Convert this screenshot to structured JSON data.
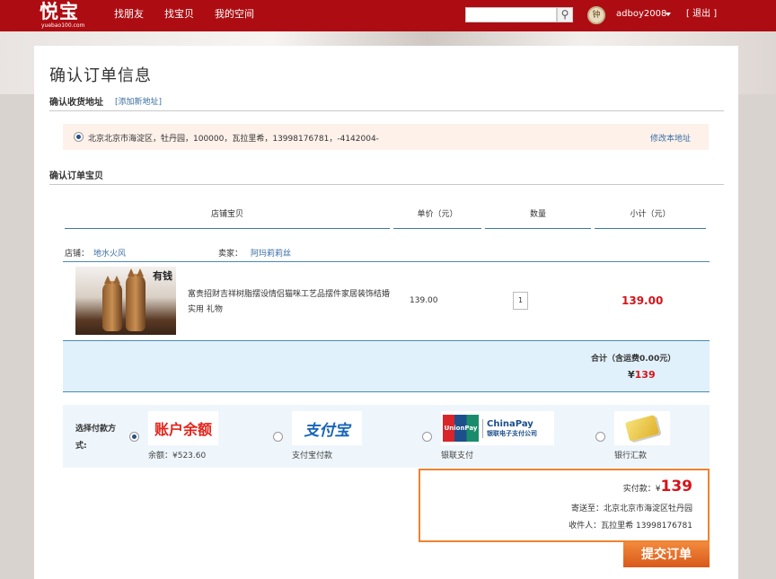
{
  "header": {
    "logo_text": "悦宝",
    "logo_sub": "yuebao100.com",
    "nav": [
      "找朋友",
      "找宝贝",
      "我的空间"
    ],
    "search_placeholder": "",
    "avatar_text": "钟",
    "username": "adboy2008",
    "logout": "[ 退出 ]"
  },
  "page": {
    "title": "确认订单信息"
  },
  "address": {
    "section_title": "确认收货地址",
    "add_link": "[添加新地址]",
    "text": "北京北京市海淀区，牡丹园，100000，瓦拉里希，13998176781，-4142004-",
    "edit_link": "修改本地址",
    "selected": true
  },
  "items": {
    "section_title": "确认订单宝贝",
    "headers": [
      "店铺宝贝",
      "单价（元）",
      "数量",
      "小计（元）"
    ],
    "shop_label": "店铺：",
    "shop_name": "地水火风",
    "seller_label": "卖家：",
    "seller_name": "阿玛莉莉丝",
    "image_caption": "有钱",
    "name": "富贵招财吉祥树脂摆设情侣猫咪工艺品摆件家居装饰结婚实用 礼物",
    "price": "139.00",
    "quantity": "1",
    "subtotal": "139.00"
  },
  "total": {
    "label": "合计（含运费0.00元）",
    "currency": "¥",
    "amount": "139"
  },
  "payment": {
    "label": "选择付款方式:",
    "options": [
      {
        "logo": "账户余额",
        "caption": "余额：¥523.60",
        "selected": true
      },
      {
        "logo": "支付宝",
        "caption": "支付宝付款",
        "selected": false
      },
      {
        "logo": "ChinaPay 银联电子支付公司",
        "logo_a": "UnionPay 银联",
        "logo_b": "ChinaPay",
        "logo_c": "银联电子支付公司",
        "caption": "银联支付",
        "selected": false
      },
      {
        "logo": "",
        "caption": "银行汇款",
        "selected": false
      }
    ]
  },
  "summary": {
    "pay_label": "实付款：",
    "currency": "¥",
    "pay_amount": "139",
    "ship_to": "寄送至：北京北京市海淀区牡丹园",
    "receiver": "收件人：瓦拉里希 13998176781"
  },
  "submit_label": "提交订单",
  "colors": {
    "topbar": "#ad0d12",
    "price_red": "#d4141a",
    "accent_orange": "#f0822d",
    "link_blue": "#3a6ea5"
  }
}
